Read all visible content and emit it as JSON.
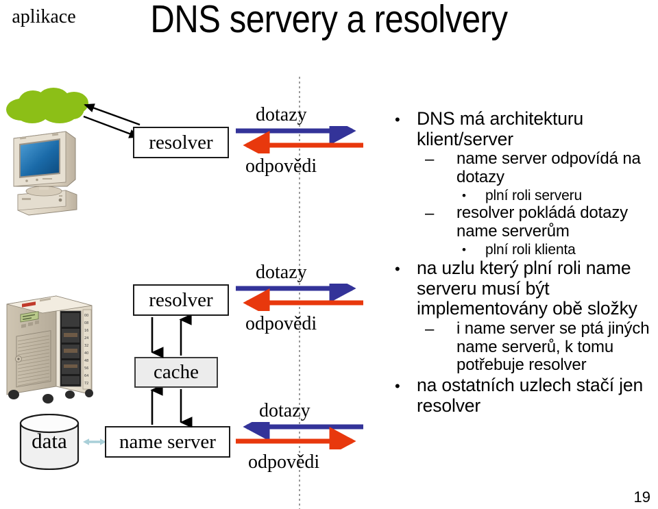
{
  "slide": {
    "title": "DNS servery a resolvery",
    "page_number": "19",
    "background_color": "#ffffff"
  },
  "colors": {
    "query_arrow": "#333399",
    "reply_arrow": "#e8380d",
    "cloud_green": "#8cbf17",
    "cache_fill": "#ececec",
    "data_link_arrow": "#a9cfd8",
    "box_border": "#1a1a1a",
    "divider": "#9a9a9a"
  },
  "diagram": {
    "cloud_label": "aplikace",
    "cylinder_label": "data",
    "boxes": {
      "resolver_top": "resolver",
      "resolver_mid": "resolver",
      "cache": "cache",
      "name_server": "name server"
    },
    "channels": [
      {
        "id": "top",
        "query_label": "dotazy",
        "reply_label": "odpovědi",
        "query_direction": "right",
        "reply_direction": "left"
      },
      {
        "id": "middle",
        "query_label": "dotazy",
        "reply_label": "odpovědi",
        "query_direction": "right",
        "reply_direction": "left"
      },
      {
        "id": "bottom",
        "query_label": "dotazy",
        "reply_label": "odpovědi",
        "query_direction": "left",
        "reply_direction": "right"
      }
    ],
    "icons": {
      "workstation": "desktop-computer-icon",
      "server": "server-tower-icon",
      "database": "database-cylinder-icon",
      "cloud": "cloud-icon"
    }
  },
  "bullets": [
    {
      "level": 1,
      "marker": "•",
      "text": "DNS má architekturu klient/server"
    },
    {
      "level": 2,
      "marker": "–",
      "text": "name server odpovídá na dotazy"
    },
    {
      "level": 3,
      "marker": "•",
      "text": "plní roli serveru"
    },
    {
      "level": 2,
      "marker": "–",
      "text": "resolver pokládá dotazy name serverům"
    },
    {
      "level": 3,
      "marker": "•",
      "text": "plní roli klienta"
    },
    {
      "level": 1,
      "marker": "•",
      "text": "na uzlu který plní roli name serveru musí být implementovány obě složky"
    },
    {
      "level": 2,
      "marker": "–",
      "text": "i name server se ptá jiných name serverů, k tomu potřebuje resolver"
    },
    {
      "level": 1,
      "marker": "•",
      "text": "na ostatních uzlech stačí jen resolver"
    }
  ]
}
